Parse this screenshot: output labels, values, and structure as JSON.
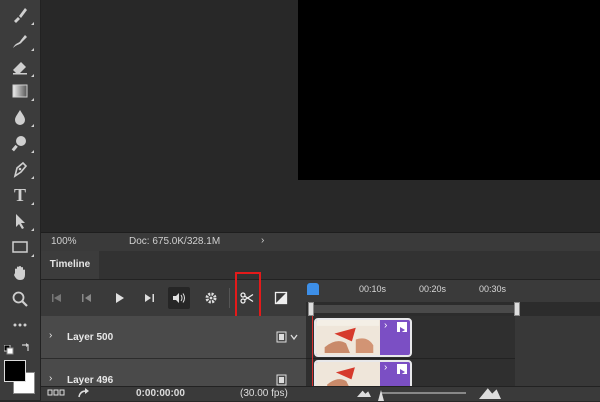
{
  "tools": [
    {
      "name": "brush-icon"
    },
    {
      "name": "clone-stamp-icon"
    },
    {
      "name": "eraser-icon"
    },
    {
      "name": "gradient-icon"
    },
    {
      "name": "blur-icon"
    },
    {
      "name": "dodge-icon"
    },
    {
      "name": "pen-icon"
    },
    {
      "name": "type-icon"
    },
    {
      "name": "path-select-icon"
    },
    {
      "name": "rectangle-icon"
    },
    {
      "name": "hand-icon"
    },
    {
      "name": "zoom-icon"
    },
    {
      "name": "more-tools-icon"
    }
  ],
  "type_tool_glyph": "T",
  "status": {
    "zoom": "100%",
    "doc": "Doc: 675.0K/328.1M",
    "arrow": "›"
  },
  "timeline": {
    "tab_label": "Timeline",
    "ruler_ticks": [
      "00:10s",
      "00:20s",
      "00:30s"
    ],
    "layers": [
      {
        "name": "Layer 500",
        "chevron": "›"
      },
      {
        "name": "Layer 496",
        "chevron": "›"
      }
    ],
    "clip_chevron": "›",
    "current_time": "0:00:00:00",
    "fps": "(30.00 fps)",
    "zoom_slider_level": 0.0
  },
  "colors": {
    "highlight_box": "#e41a1a",
    "clip": "#7b4fc4",
    "playhead": "#3d8fe8"
  }
}
